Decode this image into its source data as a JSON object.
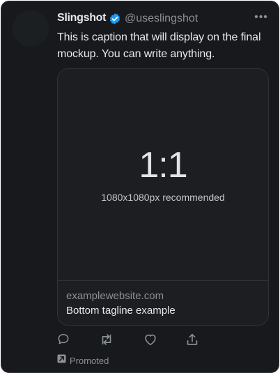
{
  "account": {
    "display_name": "Slingshot",
    "handle": "@useslingshot",
    "more_label": "•••"
  },
  "post": {
    "caption": "This is caption that will display on the final mockup. You can write anything."
  },
  "card": {
    "ratio": "1:1",
    "recommendation": "1080x1080px recommended",
    "website": "examplewebsite.com",
    "tagline": "Bottom tagline example"
  },
  "actions": [
    {
      "icon": "reply-icon"
    },
    {
      "icon": "repost-icon"
    },
    {
      "icon": "like-icon"
    },
    {
      "icon": "share-icon"
    }
  ],
  "promoted": {
    "label": "Promoted",
    "icon": "promoted-icon"
  },
  "colors": {
    "background": "#17191c",
    "text": "#e7e9ea",
    "muted": "#8b9096",
    "verified": "#1d9bf0",
    "border": "#2f3336"
  }
}
